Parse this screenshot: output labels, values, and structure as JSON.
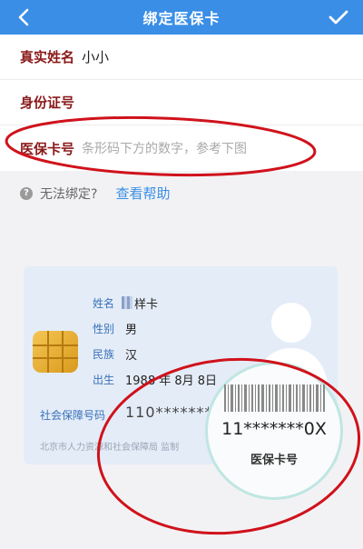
{
  "header": {
    "title": "绑定医保卡",
    "back_icon": "chevron-left-icon",
    "confirm_icon": "checkmark-icon"
  },
  "form": {
    "name_label": "真实姓名",
    "name_value": "小小",
    "id_label": "身份证号",
    "id_value": "",
    "card_label": "医保卡号",
    "card_placeholder": "条形码下方的数字，参考下图"
  },
  "help": {
    "question_icon": "?",
    "text": "无法绑定?",
    "link": "查看帮助"
  },
  "sample_card": {
    "name_label": "姓名",
    "name_value": "样卡",
    "gender_label": "性别",
    "gender_value": "男",
    "ethnicity_label": "民族",
    "ethnicity_value": "汉",
    "birth_label": "出生",
    "birth_value": "1988 年 8月 8日",
    "social_label": "社会保障号码",
    "card_number": "110********88",
    "issuer": "北京市人力资源和社会保障局  监制"
  },
  "magnifier": {
    "card_number": "11*******0X",
    "label": "医保卡号"
  },
  "colors": {
    "header_bg": "#3a8ee6",
    "label": "#8b1a1a",
    "link": "#3a8ee6",
    "annotation": "#d0121b"
  }
}
